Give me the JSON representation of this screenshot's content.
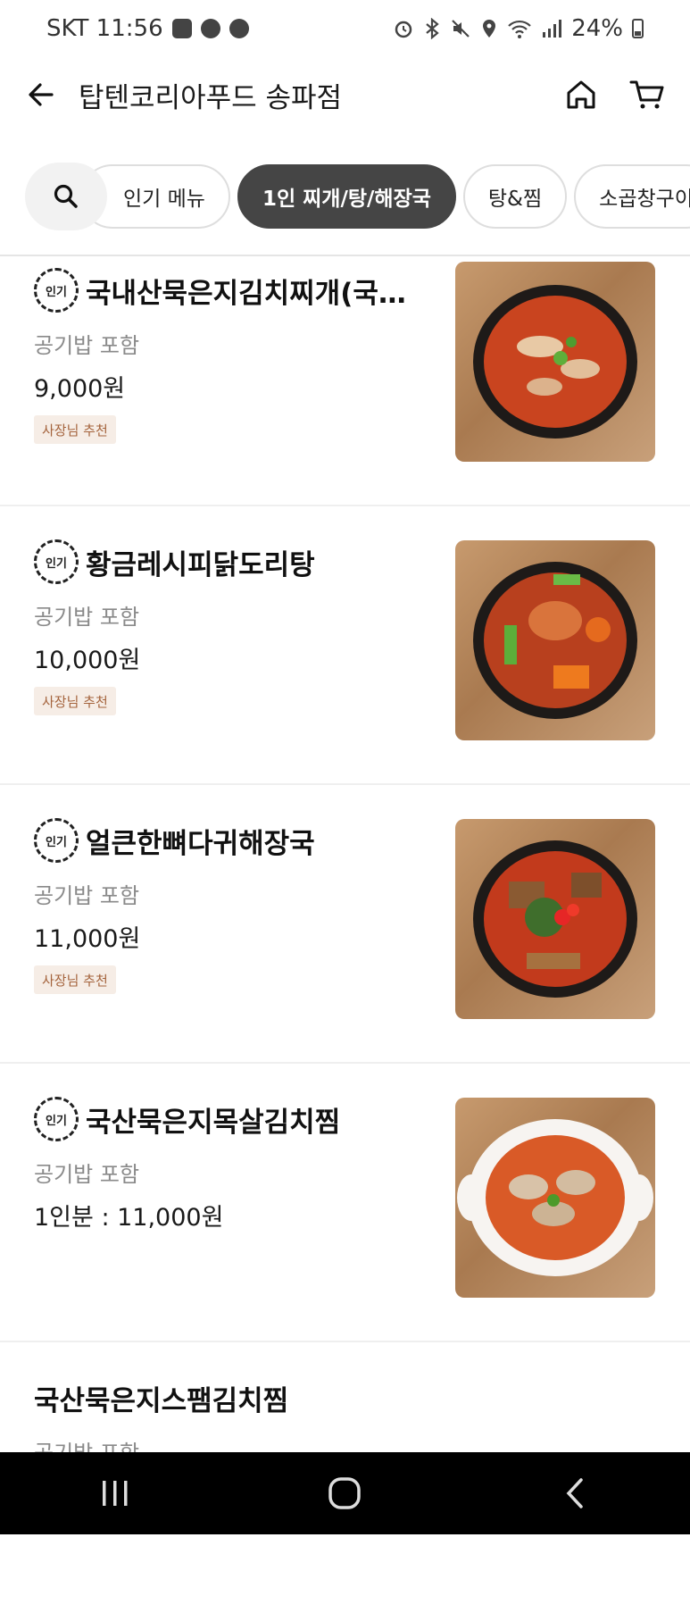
{
  "status_bar": {
    "carrier_time": "SKT 11:56",
    "battery": "24%",
    "icons": [
      "calendar-icon",
      "car-icon",
      "wear-icon",
      "alarm-icon",
      "bluetooth-icon",
      "mute-icon",
      "location-icon",
      "wifi-icon",
      "signal-icon",
      "battery-icon"
    ]
  },
  "header": {
    "title": "탑텐코리아푸드 송파점",
    "icons": [
      "back-arrow-icon",
      "home-icon",
      "cart-icon"
    ]
  },
  "tabs": [
    {
      "label": "인기 메뉴",
      "active": false
    },
    {
      "label": "1인 찌개/탕/해장국",
      "active": true
    },
    {
      "label": "탕&찜",
      "active": false
    },
    {
      "label": "소곱창구이",
      "active": false
    }
  ],
  "items": [
    {
      "popular_badge": "인기",
      "name": "국내산묵은지김치찌개(국내산돼지고기)",
      "desc": "공기밥 포함",
      "price": "9,000원",
      "recommend": "사장님 추천"
    },
    {
      "popular_badge": "인기",
      "name": "황금레시피닭도리탕",
      "desc": "공기밥 포함",
      "price": "10,000원",
      "recommend": "사장님 추천"
    },
    {
      "popular_badge": "인기",
      "name": "얼큰한뼈다귀해장국",
      "desc": "공기밥 포함",
      "price": "11,000원",
      "recommend": "사장님 추천"
    },
    {
      "popular_badge": "인기",
      "name": "국산묵은지목살김치찜",
      "desc": "공기밥 포함",
      "price": "1인분 : 11,000원",
      "recommend": ""
    },
    {
      "popular_badge": "",
      "name": "국산묵은지스팸김치찜",
      "desc": "공기밥 포함",
      "price": "",
      "recommend": ""
    }
  ],
  "colors": {
    "active_tab": "#454545",
    "recommend_bg": "#f6ede6",
    "recommend_text": "#a4633c"
  }
}
